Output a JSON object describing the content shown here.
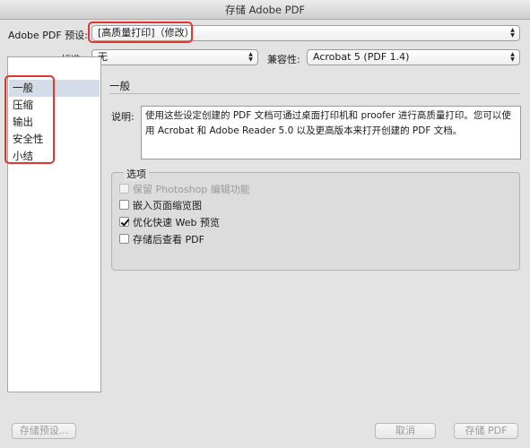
{
  "window": {
    "title": "存储 Adobe PDF"
  },
  "preset": {
    "label": "Adobe PDF 预设:",
    "value": "[高质量打印]（修改）"
  },
  "standard": {
    "label": "标准:",
    "value": "无"
  },
  "compat": {
    "label": "兼容性:",
    "value": "Acrobat 5 (PDF 1.4)"
  },
  "sidebar": {
    "items": [
      {
        "label": "一般"
      },
      {
        "label": "压缩"
      },
      {
        "label": "输出"
      },
      {
        "label": "安全性"
      },
      {
        "label": "小结"
      }
    ]
  },
  "panel": {
    "title": "一般",
    "desc_label": "说明:",
    "description": "使用这些设定创建的 PDF 文档可通过桌面打印机和 proofer 进行高质量打印。您可以使用 Acrobat 和 Adobe Reader 5.0 以及更高版本来打开创建的 PDF 文档。"
  },
  "options": {
    "title": "选项",
    "items": [
      {
        "label": "保留 Photoshop 编辑功能",
        "checked": false,
        "disabled": true
      },
      {
        "label": "嵌入页面缩览图",
        "checked": false,
        "disabled": false
      },
      {
        "label": "优化快速 Web 预览",
        "checked": true,
        "disabled": false
      },
      {
        "label": "存储后查看 PDF",
        "checked": false,
        "disabled": false
      }
    ]
  },
  "buttons": {
    "save_preset": "存储预设...",
    "cancel": "取消",
    "save_pdf": "存储 PDF"
  },
  "colors": {
    "highlight": "#e0372f",
    "selection": "#d4dce8"
  }
}
